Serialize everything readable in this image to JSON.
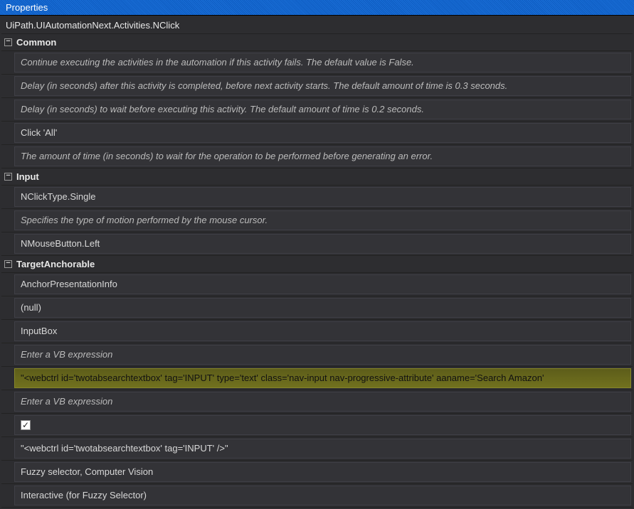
{
  "panel": {
    "title": "Properties"
  },
  "className": "UiPath.UIAutomationNext.Activities.NClick",
  "sections": {
    "common": {
      "label": "Common",
      "rows": [
        "Continue executing the activities in the automation if this activity fails. The default value is False.",
        "Delay (in seconds) after this activity is completed, before next activity starts. The default amount of time is 0.3 seconds.",
        "Delay (in seconds) to wait before executing this activity. The default amount of time is 0.2 seconds.",
        "Click 'All'",
        "The amount of time (in seconds) to wait for the operation to be performed before generating an error."
      ]
    },
    "input": {
      "label": "Input",
      "rows": [
        "NClickType.Single",
        "Specifies the type of motion performed by the mouse cursor.",
        "NMouseButton.Left"
      ]
    },
    "target": {
      "label": "TargetAnchorable",
      "rows": {
        "anchor": "AnchorPresentationInfo",
        "null": "(null)",
        "inputbox": "InputBox",
        "vb1": "Enter a VB expression",
        "selector": "\"<webctrl id='twotabsearchtextbox' tag='INPUT' type='text' class='nav-input nav-progressive-attribute' aaname='Search Amazon'",
        "vb2": "Enter a VB expression",
        "checked": true,
        "fuzzy": "\"<webctrl id='twotabsearchtextbox' tag='INPUT' />\"",
        "fuzzydesc": "Fuzzy selector, Computer Vision",
        "interactive": "Interactive (for Fuzzy Selector)"
      }
    }
  }
}
